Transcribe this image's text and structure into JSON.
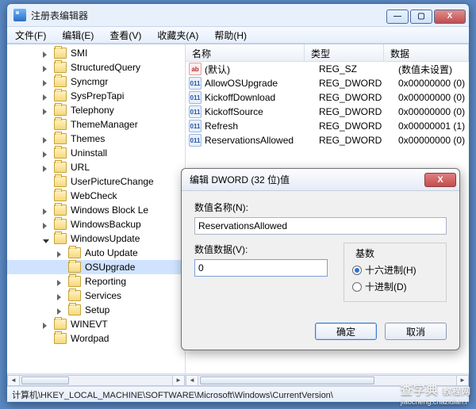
{
  "window": {
    "title": "注册表编辑器",
    "min": "—",
    "max": "▢",
    "close": "X"
  },
  "menu": {
    "file": "文件(F)",
    "edit": "编辑(E)",
    "view": "查看(V)",
    "fav": "收藏夹(A)",
    "help": "帮助(H)"
  },
  "tree": {
    "items": [
      {
        "label": "SMI",
        "level": 1,
        "exp": "right"
      },
      {
        "label": "StructuredQuery",
        "level": 1,
        "exp": "right"
      },
      {
        "label": "Syncmgr",
        "level": 1,
        "exp": "right"
      },
      {
        "label": "SysPrepTapi",
        "level": 1,
        "exp": "right"
      },
      {
        "label": "Telephony",
        "level": 1,
        "exp": "right"
      },
      {
        "label": "ThemeManager",
        "level": 1,
        "exp": "none"
      },
      {
        "label": "Themes",
        "level": 1,
        "exp": "right"
      },
      {
        "label": "Uninstall",
        "level": 1,
        "exp": "right"
      },
      {
        "label": "URL",
        "level": 1,
        "exp": "right"
      },
      {
        "label": "UserPictureChange",
        "level": 1,
        "exp": "none"
      },
      {
        "label": "WebCheck",
        "level": 1,
        "exp": "none"
      },
      {
        "label": "Windows Block Le",
        "level": 1,
        "exp": "right"
      },
      {
        "label": "WindowsBackup",
        "level": 1,
        "exp": "right"
      },
      {
        "label": "WindowsUpdate",
        "level": 1,
        "exp": "down"
      },
      {
        "label": "Auto Update",
        "level": 2,
        "exp": "right"
      },
      {
        "label": "OSUpgrade",
        "level": 2,
        "exp": "none",
        "selected": true
      },
      {
        "label": "Reporting",
        "level": 2,
        "exp": "right"
      },
      {
        "label": "Services",
        "level": 2,
        "exp": "right"
      },
      {
        "label": "Setup",
        "level": 2,
        "exp": "right"
      },
      {
        "label": "WINEVT",
        "level": 1,
        "exp": "right"
      },
      {
        "label": "Wordpad",
        "level": 1,
        "exp": "none"
      }
    ]
  },
  "columns": {
    "name": "名称",
    "type": "类型",
    "data": "数据"
  },
  "values": [
    {
      "icon": "sz",
      "name": "(默认)",
      "type": "REG_SZ",
      "data": "(数值未设置)"
    },
    {
      "icon": "dw",
      "name": "AllowOSUpgrade",
      "type": "REG_DWORD",
      "data": "0x00000000 (0)"
    },
    {
      "icon": "dw",
      "name": "KickoffDownload",
      "type": "REG_DWORD",
      "data": "0x00000000 (0)"
    },
    {
      "icon": "dw",
      "name": "KickoffSource",
      "type": "REG_DWORD",
      "data": "0x00000000 (0)"
    },
    {
      "icon": "dw",
      "name": "Refresh",
      "type": "REG_DWORD",
      "data": "0x00000001 (1)"
    },
    {
      "icon": "dw",
      "name": "ReservationsAllowed",
      "type": "REG_DWORD",
      "data": "0x00000000 (0)"
    }
  ],
  "statusbar": "计算机\\HKEY_LOCAL_MACHINE\\SOFTWARE\\Microsoft\\Windows\\CurrentVersion\\",
  "dialog": {
    "title": "编辑 DWORD (32 位)值",
    "name_label": "数值名称(N):",
    "name_value": "ReservationsAllowed",
    "data_label": "数值数据(V):",
    "data_value": "0",
    "base_label": "基数",
    "hex": "十六进制(H)",
    "dec": "十进制(D)",
    "ok": "确定",
    "cancel": "取消",
    "close": "X"
  },
  "watermark": {
    "big": "查字典",
    "small": "jiaocheng.chazidian.r",
    "tag": "教程网"
  }
}
